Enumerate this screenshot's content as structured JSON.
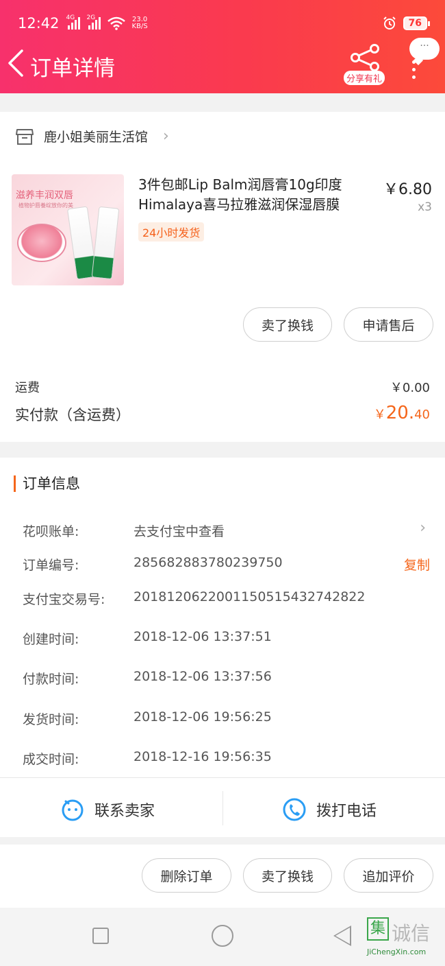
{
  "status_bar": {
    "time": "12:42",
    "net1": "4G",
    "net2": "2G",
    "speed_value": "23.0",
    "speed_unit": "KB/S",
    "battery": "76"
  },
  "nav": {
    "title": "订单详情",
    "share_label": "分享有礼",
    "more_label": "···"
  },
  "shop": {
    "name": "鹿小姐美丽生活馆"
  },
  "product": {
    "title": "3件包邮Lip Balm润唇膏10g印度Himalaya喜马拉雅滋润保湿唇膜",
    "price": "￥6.80",
    "quantity": "x3",
    "tag": "24小时发货",
    "image_text": "滋养丰润双唇",
    "image_subtext": "植物护唇養绽放你的美"
  },
  "item_actions": {
    "sell_exchange": "卖了换钱",
    "after_sales": "申请售后"
  },
  "totals": {
    "shipping_label": "运费",
    "shipping_value": "￥0.00",
    "paid_label": "实付款（含运费）",
    "paid_currency": "￥",
    "paid_integer": "20.",
    "paid_decimal": "40"
  },
  "order_info": {
    "title": "订单信息",
    "copy_label": "复制",
    "rows": [
      {
        "label": "花呗账单:",
        "value": "去支付宝中查看"
      },
      {
        "label": "订单编号:",
        "value": "285682883780239750"
      },
      {
        "label": "支付宝交易号:",
        "value": "2018120622001150515432742822"
      },
      {
        "label": "创建时间:",
        "value": "2018-12-06 13:37:51"
      },
      {
        "label": "付款时间:",
        "value": "2018-12-06 13:37:56"
      },
      {
        "label": "发货时间:",
        "value": "2018-12-06 19:56:25"
      },
      {
        "label": "成交时间:",
        "value": "2018-12-16 19:56:35"
      }
    ]
  },
  "contact": {
    "seller": "联系卖家",
    "phone": "拨打电话"
  },
  "bottom_actions": {
    "delete": "删除订单",
    "sell_exchange": "卖了换钱",
    "add_review": "追加评价"
  },
  "watermark": {
    "char": "集",
    "text": "诚信",
    "url": "JiChengXin.com"
  },
  "colors": {
    "header_start": "#f7316c",
    "header_end": "#fc4a3a",
    "accent_orange": "#f5661b",
    "icon_blue": "#2a9df4"
  }
}
